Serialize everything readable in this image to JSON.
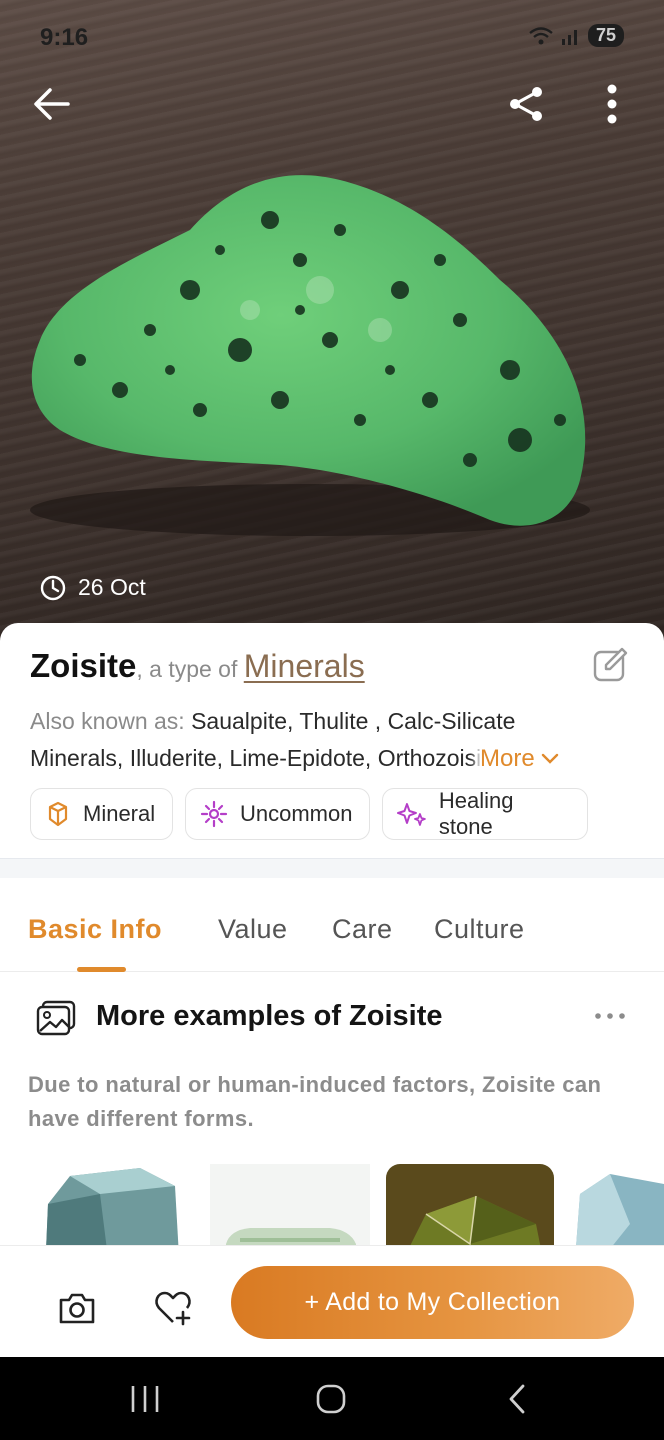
{
  "status_bar": {
    "time": "9:16",
    "battery": "75"
  },
  "hero": {
    "date": "26 Oct"
  },
  "header": {
    "name": "Zoisite",
    "type_of_text": ", a type of ",
    "category": "Minerals"
  },
  "aka": {
    "label": "Also known as: ",
    "value": "Saualpite, Thulite , Calc-Silicate Minerals, Illuderite, Lime-Epidote, Orthozoisite",
    "more_label": "More"
  },
  "tags": [
    {
      "label": "Mineral",
      "icon": "crystal-icon"
    },
    {
      "label": "Uncommon",
      "icon": "sparkle-icon"
    },
    {
      "label": "Healing stone",
      "icon": "stars-icon"
    }
  ],
  "tabs": [
    {
      "label": "Basic Info",
      "active": true
    },
    {
      "label": "Value",
      "active": false
    },
    {
      "label": "Care",
      "active": false
    },
    {
      "label": "Culture",
      "active": false
    }
  ],
  "section": {
    "title": "More examples of Zoisite",
    "description": "Due to natural or human-induced factors, Zoisite can have different forms."
  },
  "actions": {
    "add_label": "+ Add to My Collection"
  },
  "colors": {
    "accent": "#e08a2c",
    "category_link": "#8a6d51"
  }
}
